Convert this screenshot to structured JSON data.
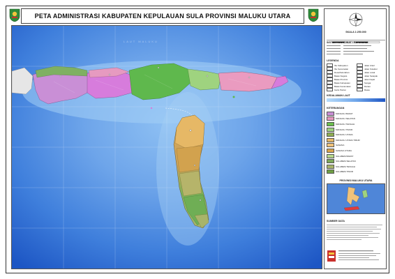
{
  "map": {
    "title": "PETA ADMINISTRASI KABUPATEN KEPULAUAN SULA PROVINSI MALUKU UTARA",
    "sea_label": "LAUT MALUKU",
    "colors": {
      "deep_sea": "#1f5fd0",
      "shallow_sea": "#7fb0ee",
      "land_magenta": "#d77cdc",
      "land_pink": "#ea9bc0",
      "land_green": "#5ab84a",
      "land_olive": "#8fa64a",
      "land_orange": "#d4a45a",
      "land_lightgreen": "#9ad27a"
    }
  },
  "panel": {
    "scale_heading": "SKALA 1:250.000",
    "info_heading": "SISTEM KOORDINAT / REFERENSI",
    "legend_heading": "LEGENDA",
    "depth_heading": "KEDALAMAN LAUT",
    "district_heading": "KETERANGAN",
    "inset_heading": "PROVINSI MALUKU UTARA",
    "source_heading": "SUMBER DATA",
    "legend_items": [
      {
        "label": "Ibu Kabupaten",
        "color": "#ffffff"
      },
      {
        "label": "Ibu Kecamatan",
        "color": "#ffffff"
      },
      {
        "label": "Desa/Kelurahan",
        "color": "#ffffff"
      },
      {
        "label": "Batas Negara",
        "color": "#ffffff"
      },
      {
        "label": "Batas Provinsi",
        "color": "#ffffff"
      },
      {
        "label": "Batas Kabupaten",
        "color": "#ffffff"
      },
      {
        "label": "Batas Kecamatan",
        "color": "#ffffff"
      },
      {
        "label": "Garis Pantai",
        "color": "#ffffff"
      }
    ],
    "legend_items_right": [
      {
        "label": "Jalan Arteri",
        "color": "#ffffff"
      },
      {
        "label": "Jalan Kolektor",
        "color": "#ffffff"
      },
      {
        "label": "Jalan Lokal",
        "color": "#ffffff"
      },
      {
        "label": "Jalan Setapak",
        "color": "#ffffff"
      },
      {
        "label": "Jalur Kapal",
        "color": "#ffffff"
      },
      {
        "label": "Sungai",
        "color": "#ffffff"
      },
      {
        "label": "Danau",
        "color": "#ffffff"
      },
      {
        "label": "Rawa",
        "color": "#ffffff"
      }
    ],
    "districts": [
      {
        "label": "MANGOLI BARAT",
        "color": "#c98fd6"
      },
      {
        "label": "MANGOLI SELATAN",
        "color": "#e69ac0"
      },
      {
        "label": "MANGOLI TENGAH",
        "color": "#6bbf4e"
      },
      {
        "label": "MANGOLI TIMUR",
        "color": "#9fd37f"
      },
      {
        "label": "MANGOLI UTARA",
        "color": "#8fae52"
      },
      {
        "label": "MANGOLI UTARA TIMUR",
        "color": "#e6b866"
      },
      {
        "label": "SANANA",
        "color": "#f0c27a"
      },
      {
        "label": "SANANA UTARA",
        "color": "#d8a54c"
      },
      {
        "label": "SULABESI BARAT",
        "color": "#b6d88a"
      },
      {
        "label": "SULABESI SELATAN",
        "color": "#7da85a"
      },
      {
        "label": "SULABESI TENGAH",
        "color": "#a8b46a"
      },
      {
        "label": "SULABESI TIMUR",
        "color": "#6f9e45"
      }
    ]
  }
}
